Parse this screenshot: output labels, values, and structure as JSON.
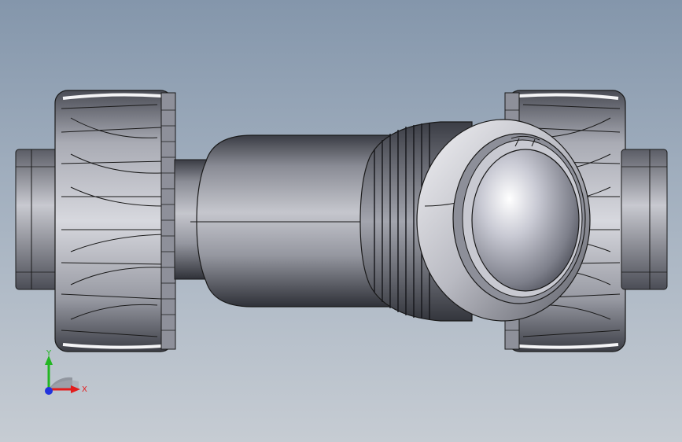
{
  "viewport": {
    "model": "true-union-ball-valve",
    "background_top": "#8496ab",
    "background_bottom": "#c6ccd3",
    "part_fill": "#b4b6bf",
    "edge_color": "#1a1a1a"
  },
  "triad": {
    "x_label": "X",
    "y_label": "Y",
    "x_color": "#e31c1c",
    "y_color": "#22b622",
    "z_color": "#2233dd"
  }
}
